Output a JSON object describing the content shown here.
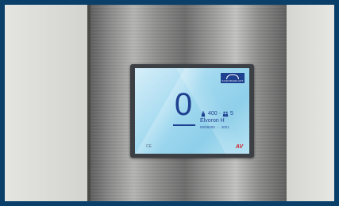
{
  "display": {
    "floor": "0",
    "capacity_kg": "400",
    "persons": "5",
    "model": "Elvoron H",
    "serial": "00/06203",
    "year": "2021",
    "logo_text": "SCHINDLER LIFT",
    "ce_mark": "CE",
    "brand_mark": "AV"
  },
  "colors": {
    "text_blue": "#1f3f8f",
    "screen_blue": "#9fd8ef",
    "brand_red": "#d0242a"
  },
  "icons": [
    "weight-icon",
    "persons-icon"
  ]
}
